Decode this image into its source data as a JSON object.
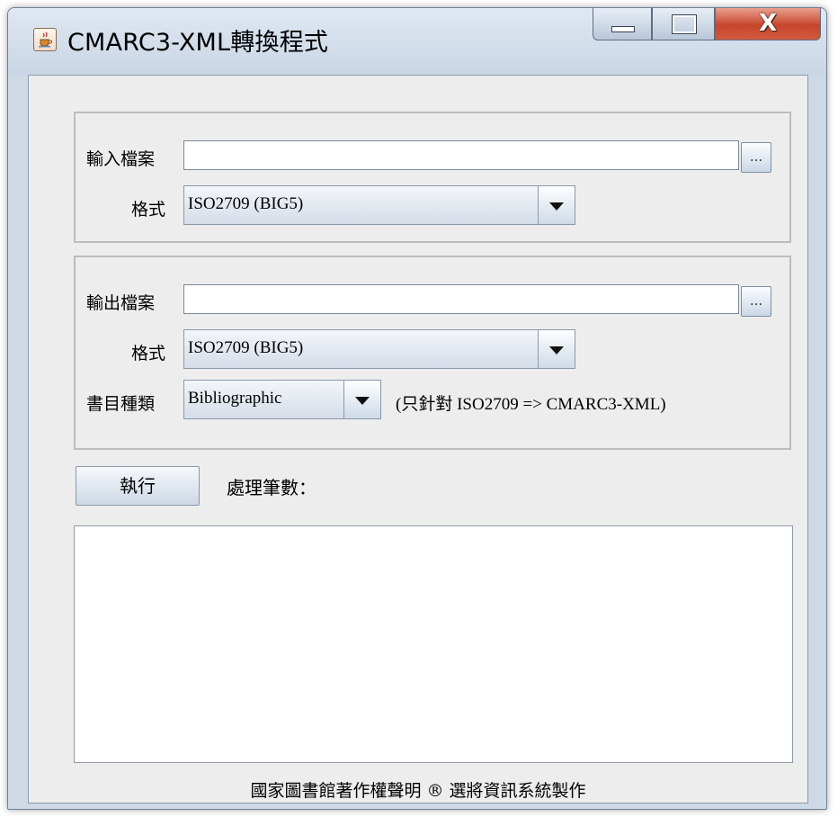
{
  "window": {
    "title": "CMARC3-XML轉換程式",
    "controls": {
      "minimize": "minimize",
      "maximize": "maximize",
      "close": "X"
    }
  },
  "input": {
    "file_label": "輸入檔案",
    "file_value": "",
    "browse_label": "...",
    "format_label": "格式",
    "format_value": "ISO2709 (BIG5)"
  },
  "output": {
    "file_label": "輸出檔案",
    "file_value": "",
    "browse_label": "...",
    "format_label": "格式",
    "format_value": "ISO2709 (BIG5)",
    "record_type_label": "書目種類",
    "record_type_value": "Bibliographic",
    "record_type_note": "(只針對 ISO2709 => CMARC3-XML)"
  },
  "actions": {
    "run_label": "執行",
    "count_label": "處理筆數："
  },
  "log": {
    "text": ""
  },
  "footer": {
    "text": "國家圖書館著作權聲明 ® 選將資訊系統製作"
  },
  "colors": {
    "close_button": "#c7452b",
    "window_frame": "#cfd9e6",
    "client_bg": "#ededed"
  },
  "icons": {
    "app": "java-cup-icon"
  }
}
